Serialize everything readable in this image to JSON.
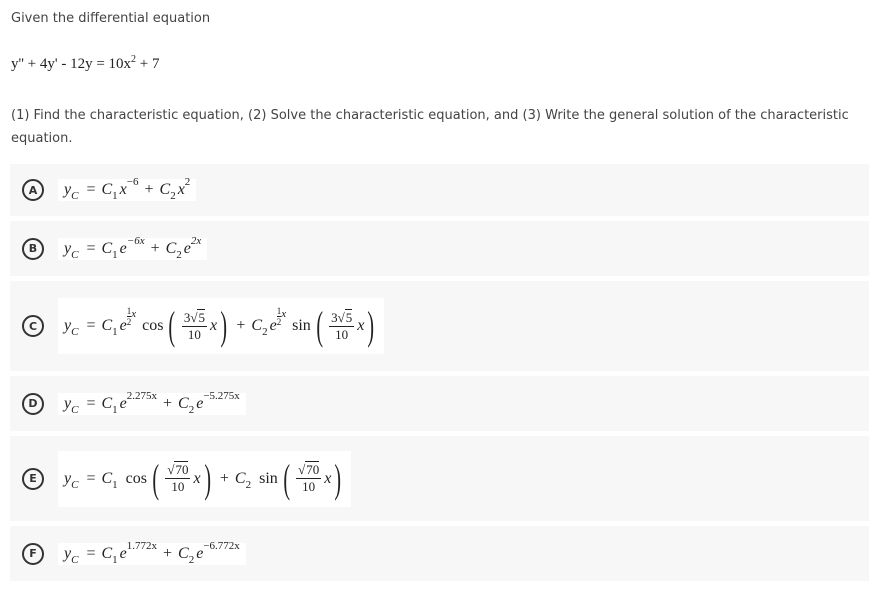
{
  "question": {
    "prompt": "Given the differential equation",
    "equation": {
      "lhs": "y'' + 4y' - 12y",
      "equals": "=",
      "rhs_base": "10x",
      "rhs_exp": "2",
      "rhs_tail": "+ 7"
    },
    "instructions": "(1) Find the characteristic equation, (2) Solve the characteristic equation, and (3) Write the general solution of the characteristic equation."
  },
  "options": [
    {
      "letter": "A",
      "text": "y_C = C_1 x^(-6) + C_2 x^2",
      "y": "y",
      "ysub": "C",
      "c1": "C",
      "c1sub": "1",
      "c2": "C",
      "c2sub": "2",
      "t1base": "x",
      "t1exp": "−6",
      "t2base": "x",
      "t2exp": "2"
    },
    {
      "letter": "B",
      "text": "y_C = C_1 e^(-6x) + C_2 e^(2x)",
      "y": "y",
      "ysub": "C",
      "c1": "C",
      "c1sub": "1",
      "c2": "C",
      "c2sub": "2",
      "t1base": "e",
      "t1exp": "−6x",
      "t2base": "e",
      "t2exp": "2x"
    },
    {
      "letter": "C",
      "text": "y_C = C_1 e^(1/2 x) cos(3√5/10 x) + C_2 e^(1/2 x) sin(3√5/10 x)",
      "y": "y",
      "ysub": "C",
      "c1": "C",
      "c1sub": "1",
      "c2": "C",
      "c2sub": "2",
      "base": "e",
      "expnum": "1",
      "expden": "2",
      "expvar": "x",
      "fn1": "cos",
      "fn2": "sin",
      "coef": "3",
      "radicand": "5",
      "den": "10",
      "var": "x"
    },
    {
      "letter": "D",
      "text": "y_C = C_1 e^(2.275x) + C_2 e^(-5.275x)",
      "y": "y",
      "ysub": "C",
      "c1": "C",
      "c1sub": "1",
      "c2": "C",
      "c2sub": "2",
      "t1base": "e",
      "t1exp": "2.275x",
      "t2base": "e",
      "t2exp": "−5.275x"
    },
    {
      "letter": "E",
      "text": "y_C = C_1 cos(√70/10 x) + C_2 sin(√70/10 x)",
      "y": "y",
      "ysub": "C",
      "c1": "C",
      "c1sub": "1",
      "c2": "C",
      "c2sub": "2",
      "fn1": "cos",
      "fn2": "sin",
      "radicand": "70",
      "den": "10",
      "var": "x"
    },
    {
      "letter": "F",
      "text": "y_C = C_1 e^(1.772x) + C_2 e^(-6.772x)",
      "y": "y",
      "ysub": "C",
      "c1": "C",
      "c1sub": "1",
      "c2": "C",
      "c2sub": "2",
      "t1base": "e",
      "t1exp": "1.772x",
      "t2base": "e",
      "t2exp": "−6.772x"
    }
  ],
  "symbols": {
    "equals": "=",
    "plus": "+",
    "sqrt": "√",
    "lparen": "(",
    "rparen": ")"
  }
}
